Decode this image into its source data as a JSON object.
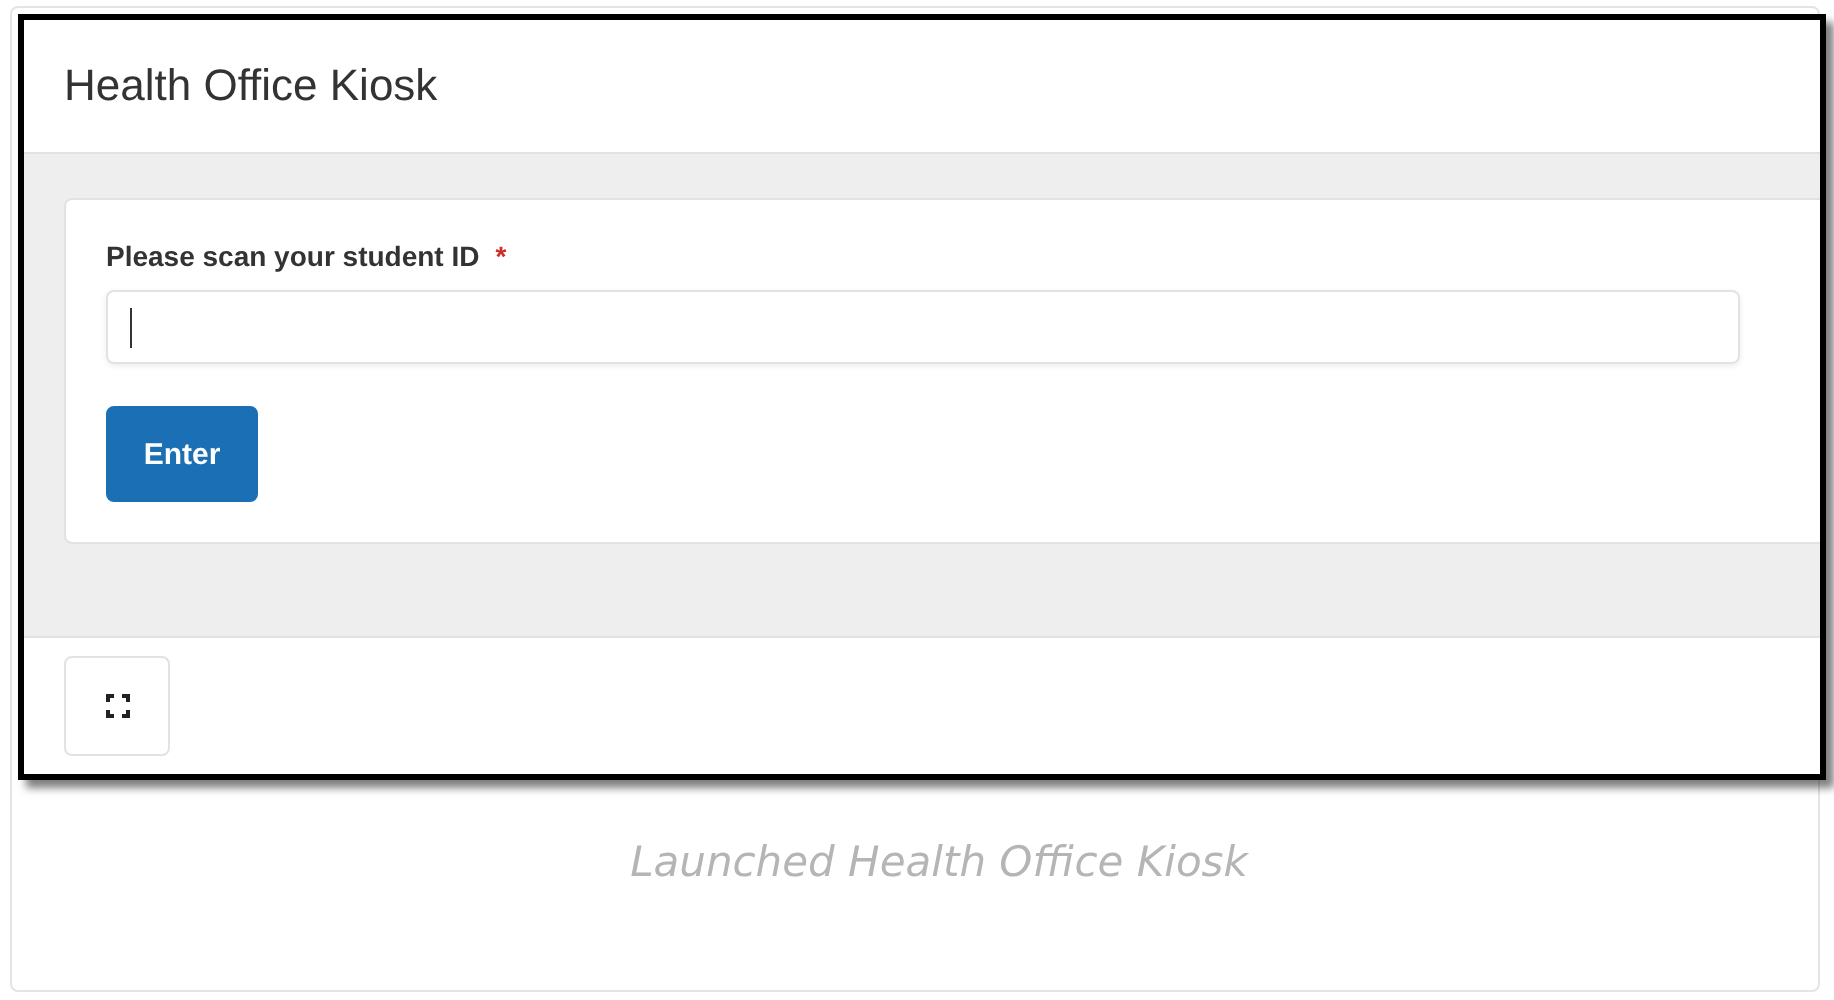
{
  "window": {
    "title": "Health Office Kiosk"
  },
  "form": {
    "label": "Please scan your student ID",
    "required_mark": "*",
    "field": {
      "focused": true
    },
    "button": "Enter"
  },
  "caption": "Launched Health Office Kiosk"
}
